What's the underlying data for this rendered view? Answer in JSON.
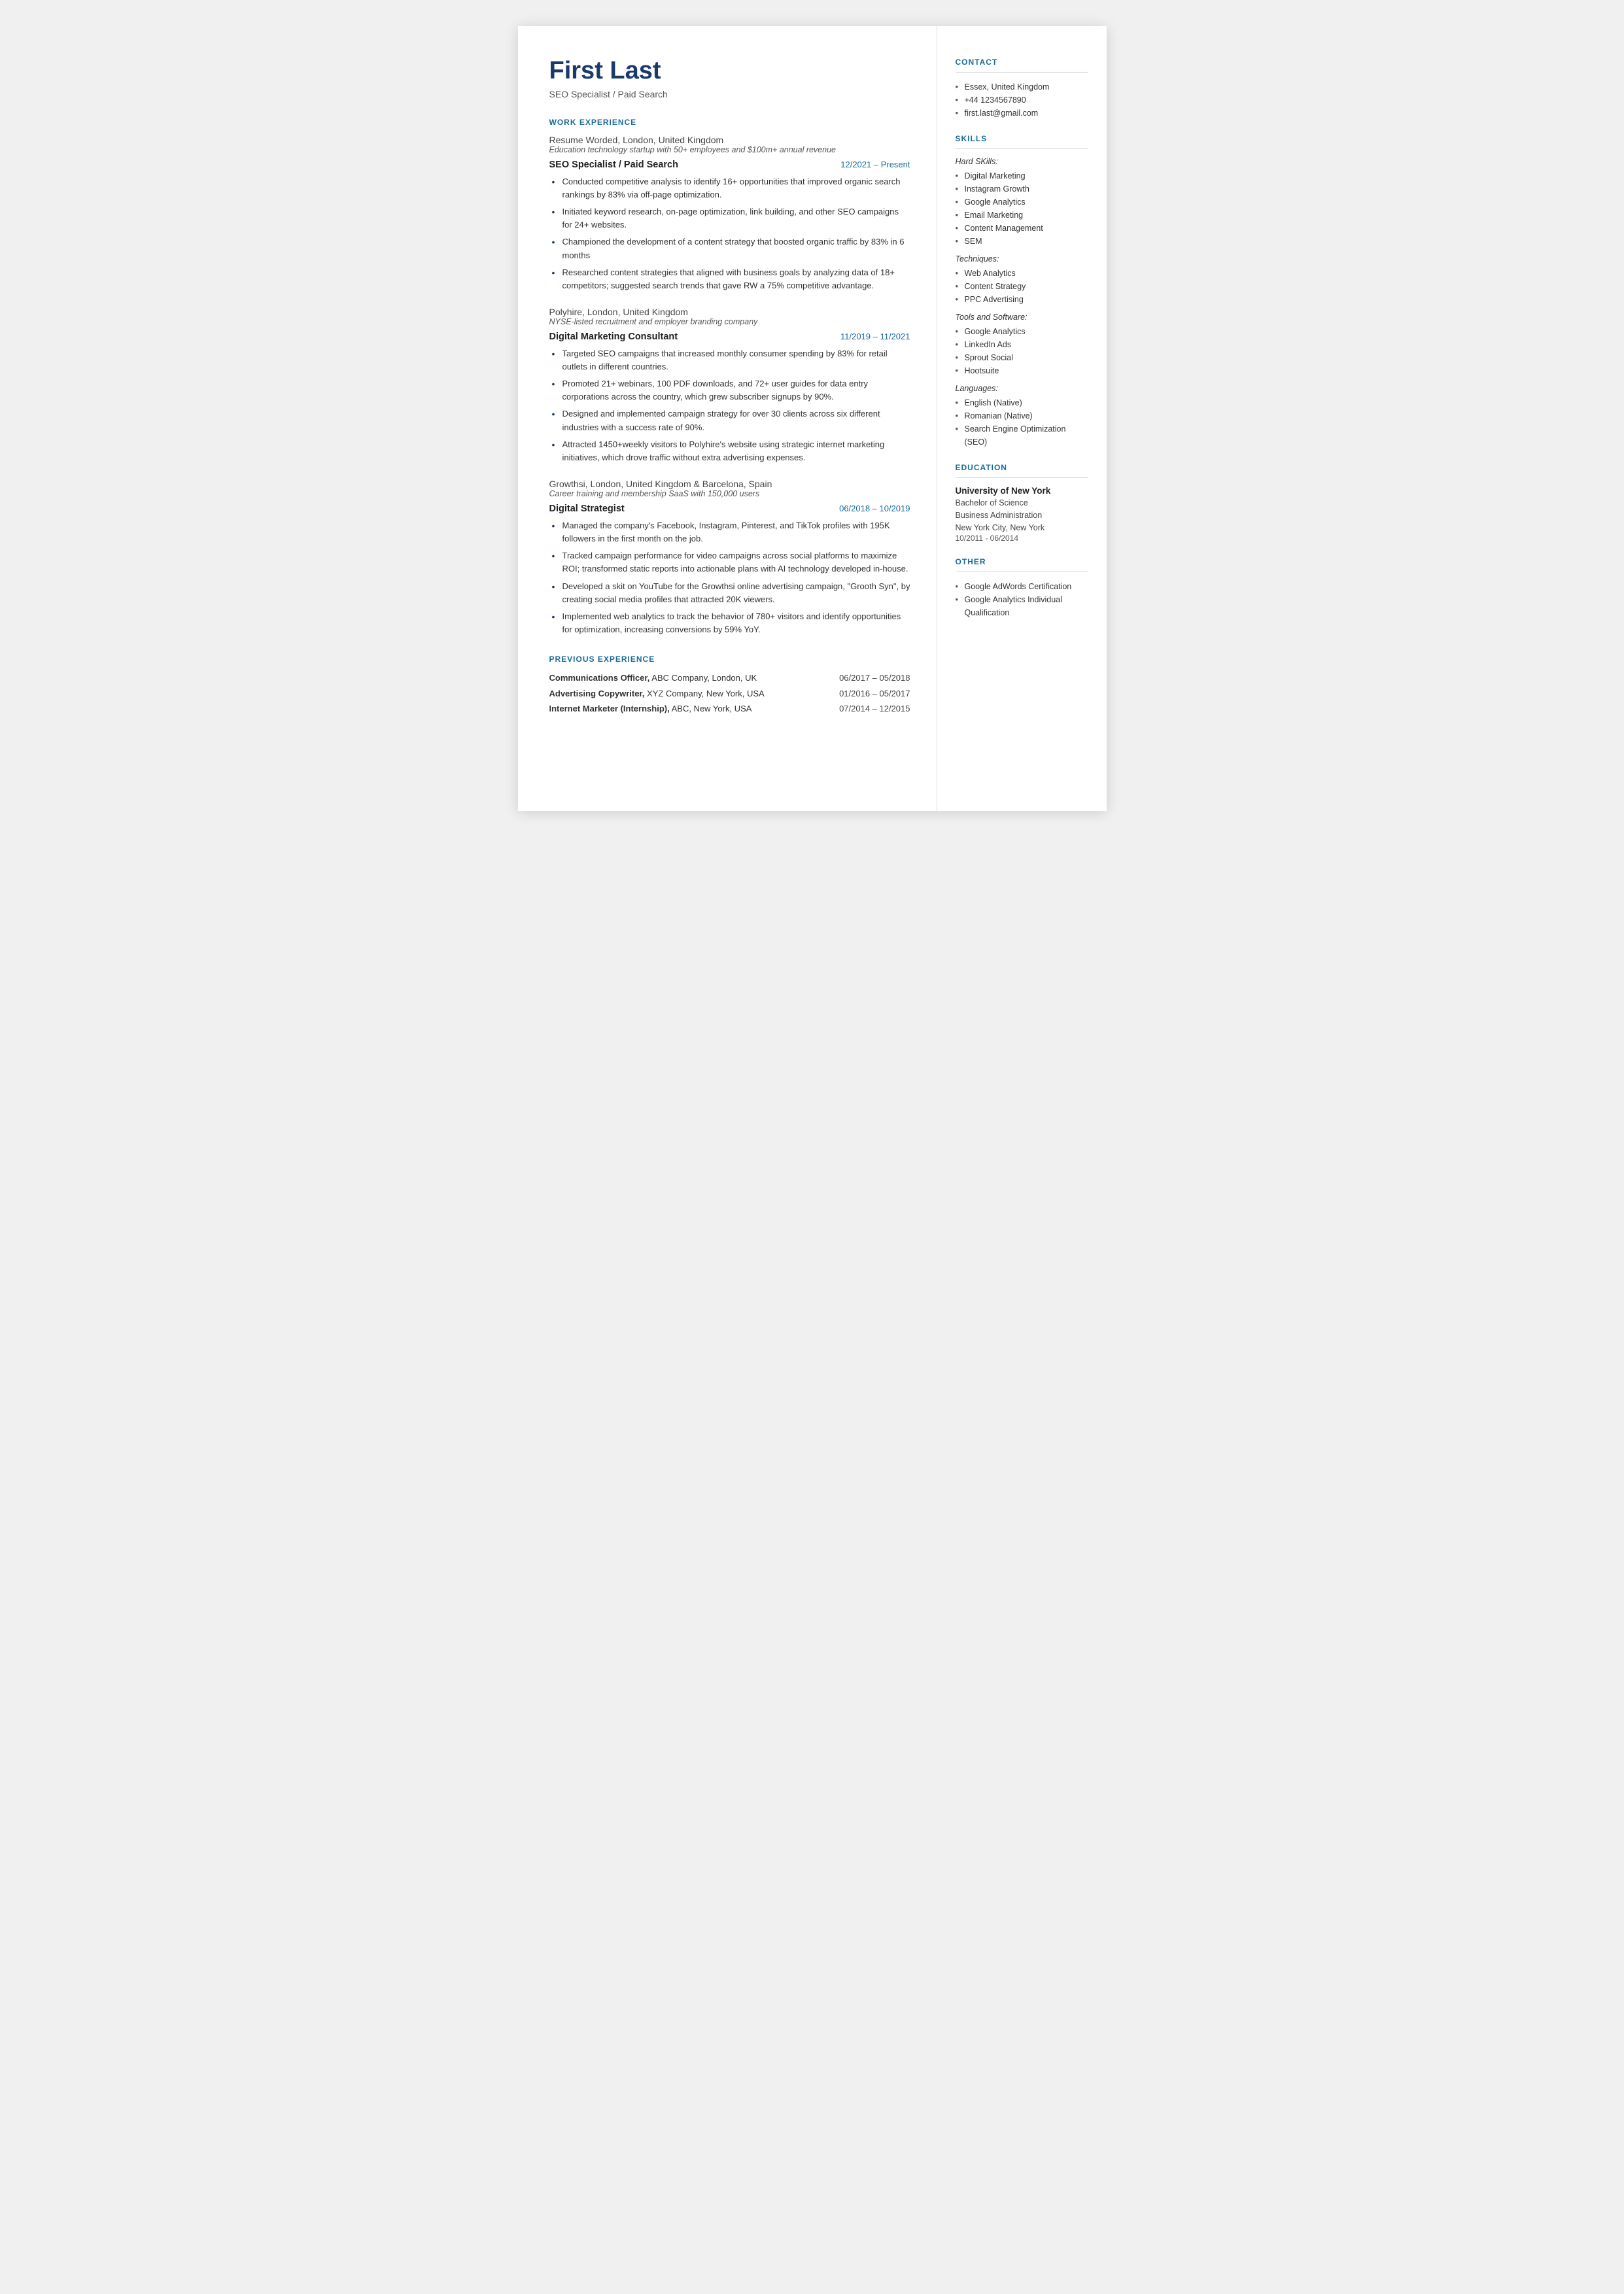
{
  "header": {
    "name": "First Last",
    "job_title": "SEO Specialist / Paid Search"
  },
  "sections": {
    "work_experience_label": "WORK EXPERIENCE",
    "previous_experience_label": "PREVIOUS EXPERIENCE"
  },
  "employers": [
    {
      "name": "Resume Worded,",
      "name_rest": " London, United Kingdom",
      "tagline": "Education technology startup with 50+ employees and $100m+ annual revenue",
      "roles": [
        {
          "title": "SEO Specialist / Paid Search",
          "dates": "12/2021 – Present",
          "bullets": [
            "Conducted competitive analysis to identify 16+ opportunities that improved organic search rankings by 83% via off-page optimization.",
            "Initiated keyword research, on-page optimization, link building, and other SEO campaigns for 24+ websites.",
            "Championed the development of a content strategy that boosted organic traffic by 83% in 6 months",
            "Researched content strategies that aligned with business goals by analyzing data of 18+ competitors; suggested search trends that gave RW a 75% competitive advantage."
          ]
        }
      ]
    },
    {
      "name": "Polyhire,",
      "name_rest": " London, United Kingdom",
      "tagline": "NYSE-listed recruitment and employer branding company",
      "roles": [
        {
          "title": "Digital Marketing Consultant",
          "dates": "11/2019 – 11/2021",
          "bullets": [
            "Targeted SEO campaigns that increased monthly consumer spending by 83% for retail outlets in different countries.",
            "Promoted 21+ webinars, 100 PDF downloads, and 72+ user guides for data entry corporations across the country, which grew subscriber signups by 90%.",
            "Designed and implemented campaign strategy for over 30 clients across six different industries with a success rate of 90%.",
            "Attracted 1450+weekly visitors to Polyhire's website using strategic internet marketing initiatives, which drove traffic without extra advertising expenses."
          ]
        }
      ]
    },
    {
      "name": "Growthsi,",
      "name_rest": " London, United Kingdom & Barcelona, Spain",
      "tagline": "Career training and membership SaaS with 150,000 users",
      "roles": [
        {
          "title": "Digital Strategist",
          "dates": "06/2018 – 10/2019",
          "bullets": [
            "Managed the company's Facebook, Instagram, Pinterest, and TikTok profiles with 195K followers in the first month on the job.",
            "Tracked campaign performance for video campaigns across social platforms to maximize ROI; transformed static reports into actionable plans with AI technology developed in-house.",
            "Developed a skit on YouTube for the Growthsi online advertising campaign, \"Grooth Syn\", by creating social media profiles that attracted 20K viewers.",
            "Implemented web analytics to track the behavior of 780+ visitors and identify opportunities for optimization, increasing conversions by 59% YoY."
          ]
        }
      ]
    }
  ],
  "previous_experience": [
    {
      "title_bold": "Communications Officer,",
      "title_rest": " ABC Company, London, UK",
      "dates": "06/2017 – 05/2018"
    },
    {
      "title_bold": "Advertising Copywriter,",
      "title_rest": " XYZ Company, New York, USA",
      "dates": "01/2016 – 05/2017"
    },
    {
      "title_bold": "Internet Marketer (Internship),",
      "title_rest": " ABC, New York, USA",
      "dates": "07/2014 – 12/2015"
    }
  ],
  "sidebar": {
    "contact_label": "CONTACT",
    "contact_items": [
      "Essex, United Kingdom",
      "+44 1234567890",
      "first.last@gmail.com"
    ],
    "skills_label": "SKILLS",
    "hard_skills_label": "Hard SKills:",
    "hard_skills": [
      "Digital Marketing",
      "Instagram Growth",
      "Google Analytics",
      "Email Marketing",
      "Content Management",
      "SEM"
    ],
    "techniques_label": "Techniques:",
    "techniques": [
      "Web Analytics",
      "Content Strategy",
      "PPC Advertising"
    ],
    "tools_label": "Tools and Software:",
    "tools": [
      "Google Analytics",
      "LinkedIn Ads",
      "Sprout Social",
      "Hootsuite"
    ],
    "languages_label": "Languages:",
    "languages": [
      "English (Native)",
      "Romanian (Native)",
      "Search Engine Optimization (SEO)"
    ],
    "education_label": "EDUCATION",
    "education": [
      {
        "institution": "University of New York",
        "degree": "Bachelor of Science",
        "field": "Business Administration",
        "location": "New York City, New York",
        "dates": "10/2011 - 06/2014"
      }
    ],
    "other_label": "OTHER",
    "other_items": [
      "Google AdWords Certification",
      "Google Analytics Individual Qualification"
    ]
  }
}
